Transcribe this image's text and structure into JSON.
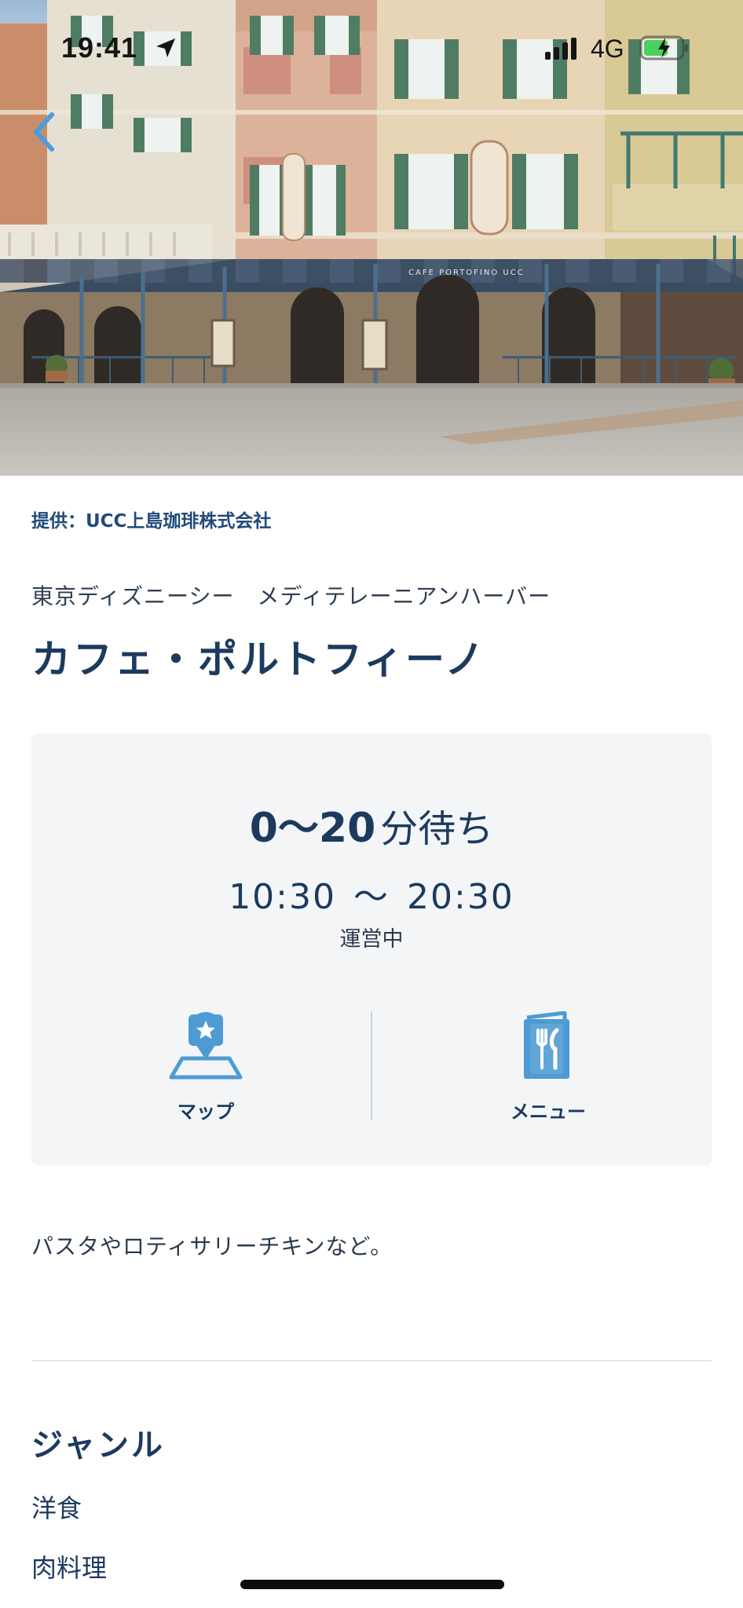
{
  "status_bar": {
    "time": "19:41",
    "network": "4G",
    "location_icon": "location-arrow-icon",
    "signal_icon": "cell-signal-icon",
    "battery_icon": "battery-charging-icon"
  },
  "navigation": {
    "back_icon": "chevron-left-icon"
  },
  "hero": {
    "sign_text": "CAFE PORTOFINO UCC"
  },
  "provider": "提供：UCC上島珈琲株式会社",
  "location": "東京ディズニーシー　メディテレーニアンハーバー",
  "title": "カフェ・ポルトフィーノ",
  "info_card": {
    "wait_range": "0～20",
    "wait_unit": "分待ち",
    "open_time": "10:30",
    "separator": "～",
    "close_time": "20:30",
    "status": "運営中",
    "actions": [
      {
        "label": "マップ",
        "icon": "map-pin-icon"
      },
      {
        "label": "メニュー",
        "icon": "menu-book-icon"
      }
    ]
  },
  "description": "パスタやロティサリーチキンなど。",
  "genre": {
    "heading": "ジャンル",
    "items": [
      "洋食",
      "肉料理"
    ]
  },
  "colors": {
    "accent": "#1c3a5e",
    "provider_text": "#214a7a",
    "icon_blue": "#4e9bd3",
    "card_background": "#f3f5f7"
  }
}
